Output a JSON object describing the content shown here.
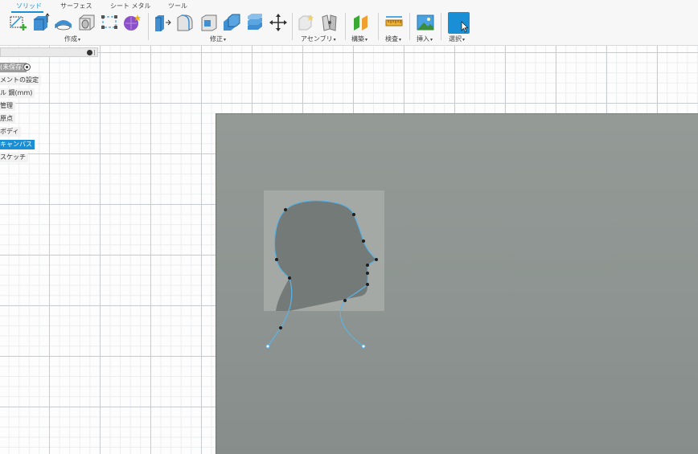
{
  "toolbar": {
    "tabs": [
      "ソリッド",
      "サーフェス",
      "シート メタル",
      "ツール"
    ],
    "active_tab": "ソリッド",
    "groups": {
      "create": "作成",
      "modify": "修正",
      "assemble": "アセンブリ",
      "construct": "構築",
      "inspect": "検査",
      "insert": "挿入",
      "select": "選択"
    },
    "dropdown_arrow": "▾"
  },
  "browser": {
    "items": [
      {
        "label": "(未保存)"
      },
      {
        "label": "メントの設定"
      },
      {
        "label": "ル 鋼(mm)"
      },
      {
        "label": "管理"
      },
      {
        "label": "原点"
      },
      {
        "label": "ボディ"
      },
      {
        "label": "キャンバス"
      },
      {
        "label": "スケッチ"
      }
    ]
  },
  "colors": {
    "accent": "#1a8fd6",
    "sketch_curve": "#5ab4e6",
    "canvas_plane": "#8f9693",
    "silhouette": "#747a78"
  }
}
